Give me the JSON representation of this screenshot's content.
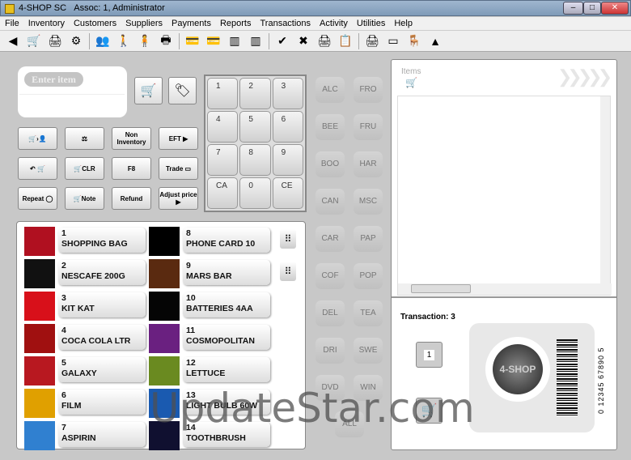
{
  "window": {
    "title": "4-SHOP SC",
    "assoc": "Assoc: 1, Administrator",
    "min": "–",
    "max": "□",
    "close": "✕"
  },
  "menu": [
    "File",
    "Inventory",
    "Customers",
    "Suppliers",
    "Payments",
    "Reports",
    "Transactions",
    "Activity",
    "Utilities",
    "Help"
  ],
  "toolbar": [
    [
      "back-icon",
      "◀"
    ],
    [
      "cart-icon",
      "🛒"
    ],
    [
      "printer-stop-icon",
      "🖨"
    ],
    [
      "settings-icon",
      "⚙"
    ],
    null,
    [
      "users-icon",
      "👥"
    ],
    [
      "person-icon",
      "🚶"
    ],
    [
      "customer-icon",
      "🧍"
    ],
    [
      "print-doc-icon",
      "🖶"
    ],
    null,
    [
      "card-icon",
      "💳"
    ],
    [
      "card-delete-icon",
      "💳"
    ],
    [
      "barcode-icon",
      "▥"
    ],
    [
      "barcode-delete-icon",
      "▥"
    ],
    null,
    [
      "approve-icon",
      "✔"
    ],
    [
      "reject-icon",
      "✖"
    ],
    [
      "print-receipt-icon",
      "🖨"
    ],
    [
      "notes-icon",
      "📋"
    ],
    null,
    [
      "print-mail-icon",
      "🖨"
    ],
    [
      "sold-icon",
      "▭"
    ],
    [
      "seat-icon",
      "🪑"
    ],
    [
      "supplier-icon",
      "▲"
    ]
  ],
  "entry": {
    "label": "Enter item",
    "value": ""
  },
  "functions": [
    {
      "name": "cart-to-customer-button",
      "label": "🛒›👤"
    },
    {
      "name": "scale-button",
      "label": "⚖"
    },
    {
      "name": "non-inventory-button",
      "label": "Non Inventory"
    },
    {
      "name": "eft-button",
      "label": "EFT ▶"
    },
    {
      "name": "return-cart-button",
      "label": "↶ 🛒"
    },
    {
      "name": "clear-cart-button",
      "label": "🛒CLR"
    },
    {
      "name": "cash-drawer-button",
      "label": "F8"
    },
    {
      "name": "trade-button",
      "label": "Trade ▭"
    },
    {
      "name": "repeat-button",
      "label": "Repeat ◯"
    },
    {
      "name": "note-button",
      "label": "🛒Note"
    },
    {
      "name": "refund-button",
      "label": "Refund"
    },
    {
      "name": "adjust-price-button",
      "label": "Adjust price ▶"
    }
  ],
  "keypad": [
    "1",
    "2",
    "3",
    "4",
    "5",
    "6",
    "7",
    "8",
    "9",
    "CA",
    "0",
    "CE"
  ],
  "categories": [
    "ALC",
    "FRO",
    "BEE",
    "FRU",
    "BOO",
    "HAR",
    "CAN",
    "MSC",
    "CAR",
    "PAP",
    "COF",
    "POP",
    "DEL",
    "TEA",
    "DRI",
    "SWE",
    "DVD",
    "WIN"
  ],
  "all_label": "ALL",
  "products": [
    {
      "num": "1",
      "name": "SHOPPING BAG",
      "color": "#b01020"
    },
    {
      "num": "2",
      "name": "NESCAFE 200G",
      "color": "#111111"
    },
    {
      "num": "3",
      "name": "KIT KAT",
      "color": "#d8101a"
    },
    {
      "num": "4",
      "name": "COCA COLA LTR",
      "color": "#a01010"
    },
    {
      "num": "5",
      "name": "GALAXY",
      "color": "#b81820"
    },
    {
      "num": "6",
      "name": "FILM",
      "color": "#e0a000"
    },
    {
      "num": "7",
      "name": "ASPIRIN",
      "color": "#3080d0"
    },
    {
      "num": "8",
      "name": "PHONE CARD 10",
      "color": "#000000"
    },
    {
      "num": "9",
      "name": "MARS BAR",
      "color": "#5a2a10"
    },
    {
      "num": "10",
      "name": "BATTERIES 4AA",
      "color": "#050505"
    },
    {
      "num": "11",
      "name": "COSMOPOLITAN",
      "color": "#6a2080"
    },
    {
      "num": "12",
      "name": "LETTUCE",
      "color": "#6a8a20"
    },
    {
      "num": "13",
      "name": "LIGHT BULB 60W",
      "color": "#1a5ab0"
    },
    {
      "num": "14",
      "name": "TOOTHBRUSH",
      "color": "#101030"
    }
  ],
  "right": {
    "items_label": "Items",
    "transaction": "Transaction: 3",
    "queue_num": "1",
    "logo": "4-SHOP",
    "barcode": "0 12345 67890 5"
  },
  "watermark": "UpdateStar.com"
}
